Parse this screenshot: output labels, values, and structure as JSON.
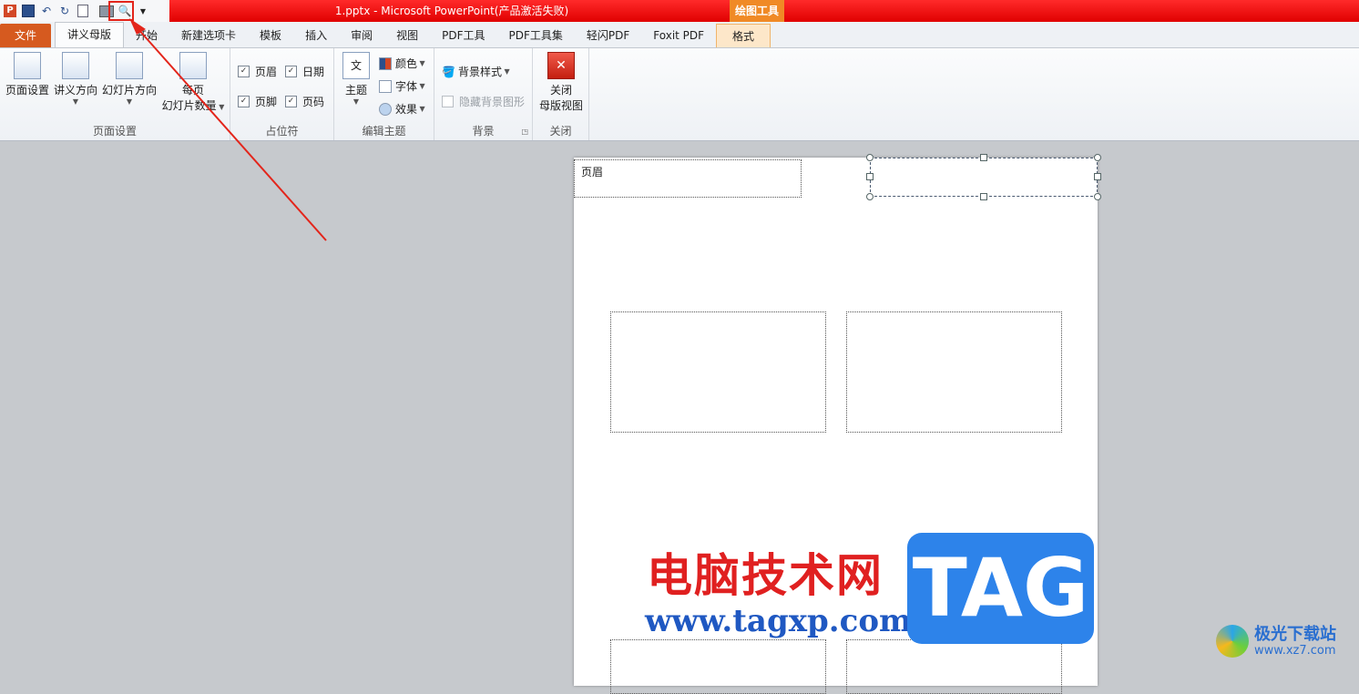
{
  "window": {
    "title": "1.pptx - Microsoft PowerPoint(产品激活失败)",
    "contextual_group": "绘图工具"
  },
  "quick_access": {
    "icons": [
      "powerpoint-logo-icon",
      "save-icon",
      "undo-icon",
      "redo-icon",
      "new-slide-icon",
      "print-icon",
      "print-preview-icon",
      "customize-qat-icon"
    ]
  },
  "tabs": [
    {
      "label": "文件",
      "kind": "file"
    },
    {
      "label": "讲义母版",
      "kind": "active"
    },
    {
      "label": "开始"
    },
    {
      "label": "新建选项卡"
    },
    {
      "label": "模板"
    },
    {
      "label": "插入"
    },
    {
      "label": "审阅"
    },
    {
      "label": "视图"
    },
    {
      "label": "PDF工具"
    },
    {
      "label": "PDF工具集"
    },
    {
      "label": "轻闪PDF"
    },
    {
      "label": "Foxit PDF"
    },
    {
      "label": "格式",
      "kind": "contextual"
    }
  ],
  "ribbon": {
    "page_setup": {
      "label": "页面设置",
      "page_setup_btn": "页面设置",
      "handout_orientation": "讲义方向",
      "slide_orientation": "幻灯片方向",
      "slides_per_page_1": "每页",
      "slides_per_page_2": "幻灯片数量"
    },
    "placeholders": {
      "label": "占位符",
      "header": "页眉",
      "date": "日期",
      "footer": "页脚",
      "page_number": "页码"
    },
    "edit_theme": {
      "label": "编辑主题",
      "theme": "主题",
      "colors": "颜色",
      "fonts": "字体",
      "effects": "效果"
    },
    "background": {
      "label": "背景",
      "styles": "背景样式",
      "hide_graphics": "隐藏背景图形"
    },
    "close": {
      "label": "关闭",
      "btn_1": "关闭",
      "btn_2": "母版视图"
    }
  },
  "document": {
    "header_placeholder": "页眉"
  },
  "watermark": {
    "cn": "电脑技术网",
    "url": "www.tagxp.com",
    "tag": "TAG",
    "site_name": "极光下载站",
    "site_url": "www.xz7.com"
  },
  "colors": {
    "title_red": "#e00000",
    "file_tab": "#d65a1f",
    "contextual": "#f08a26",
    "annotation_red": "#e3251b"
  }
}
